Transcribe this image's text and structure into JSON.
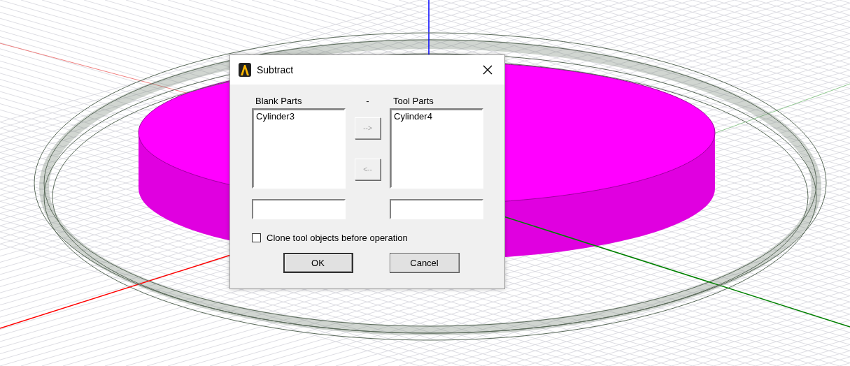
{
  "dialog": {
    "title": "Subtract",
    "blank_parts": {
      "label": "Blank Parts",
      "items": [
        {
          "text": "Cylinder3",
          "selected": false
        }
      ]
    },
    "separator": "-",
    "tool_parts": {
      "label": "Tool Parts",
      "items": [
        {
          "text": "Cylinder4",
          "selected": false
        }
      ]
    },
    "move_buttons": [
      {
        "label": "-->",
        "disabled": true
      },
      {
        "label": "<--",
        "disabled": true
      }
    ],
    "clone_checkbox": {
      "label": "Clone tool objects before operation",
      "checked": false
    },
    "buttons": [
      {
        "label": "OK",
        "default": true
      },
      {
        "label": "Cancel",
        "default": false
      }
    ]
  }
}
